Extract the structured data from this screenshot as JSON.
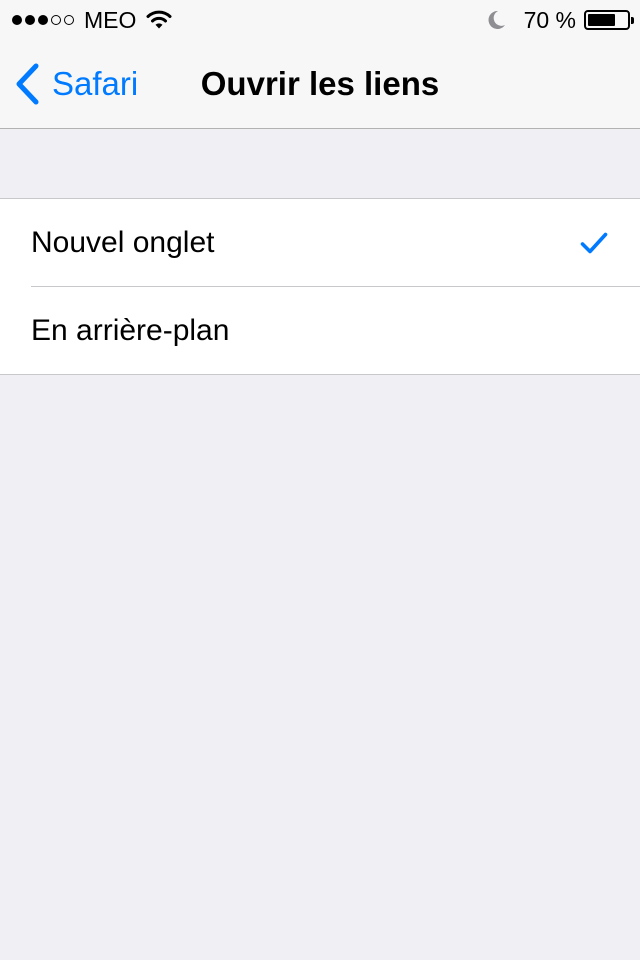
{
  "status_bar": {
    "signal_bars_total": 5,
    "signal_bars_filled": 3,
    "carrier": "MEO",
    "battery_text": "70 %",
    "battery_level": 0.7,
    "icons": [
      "wifi-icon",
      "moon-icon",
      "battery-icon"
    ]
  },
  "nav": {
    "back_label": "Safari",
    "title": "Ouvrir les liens"
  },
  "options": [
    {
      "label": "Nouvel onglet",
      "selected": true
    },
    {
      "label": "En arrière-plan",
      "selected": false
    }
  ],
  "colors": {
    "accent": "#007aff",
    "background": "#efeff4",
    "bar_background": "#f7f7f7",
    "separator": "#c8c7cc"
  }
}
